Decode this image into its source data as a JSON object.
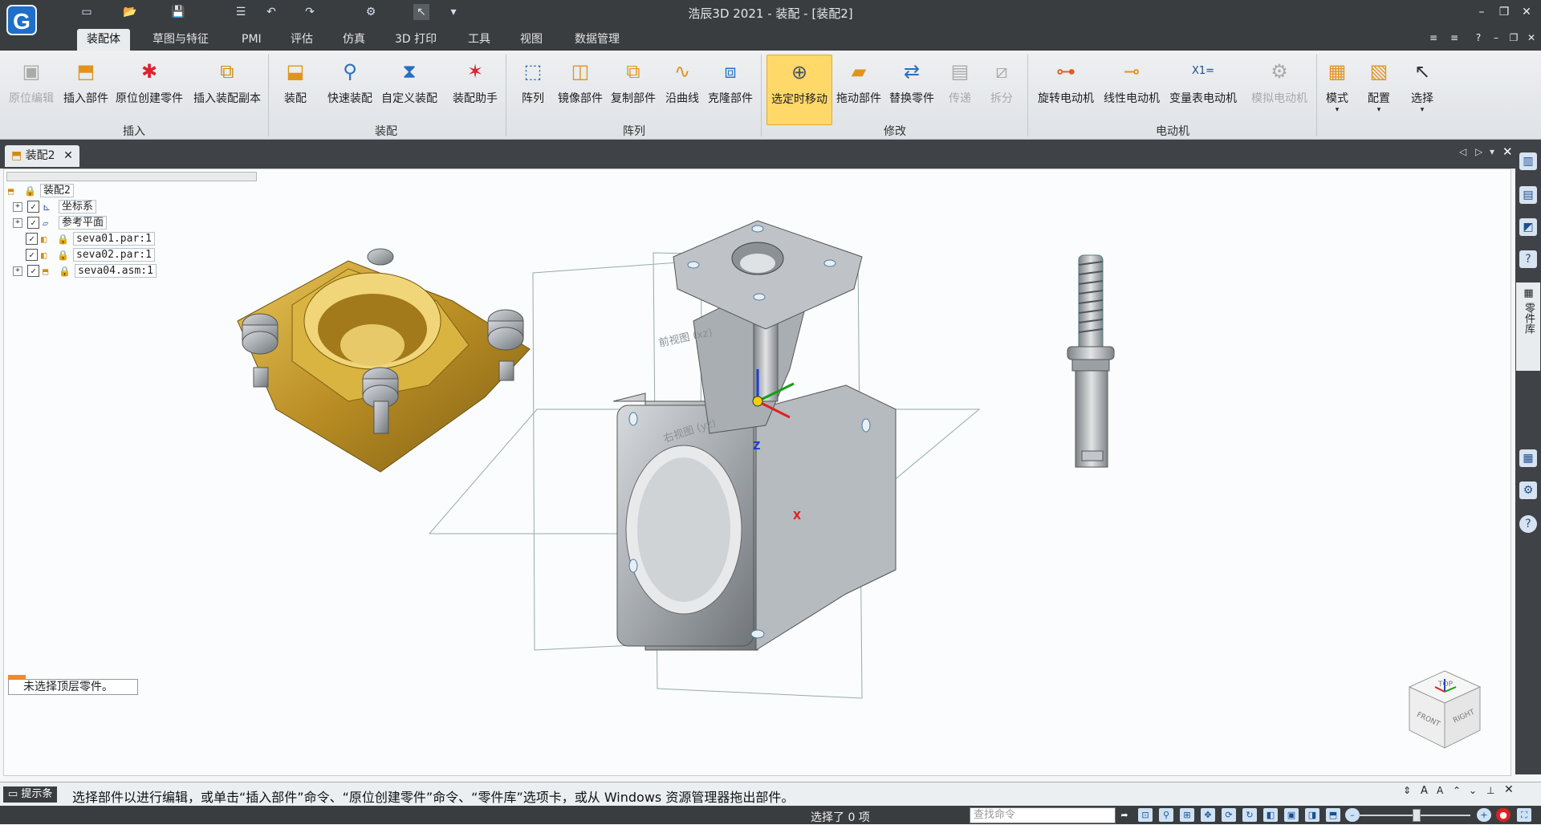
{
  "window": {
    "title": "浩辰3D 2021 - 装配 - [装配2]"
  },
  "quick_access_icons": [
    "new-icon",
    "open-icon",
    "save-icon",
    "undo-icon",
    "redo-icon",
    "select-icon"
  ],
  "ribbon_tabs": [
    {
      "label": "装配体",
      "active": true
    },
    {
      "label": "草图与特征"
    },
    {
      "label": "PMI"
    },
    {
      "label": "评估"
    },
    {
      "label": "仿真"
    },
    {
      "label": "3D 打印"
    },
    {
      "label": "工具"
    },
    {
      "label": "视图"
    },
    {
      "label": "数据管理"
    }
  ],
  "ribbon": {
    "groups": [
      "插入",
      "装配",
      "阵列",
      "修改",
      "电动机"
    ],
    "buttons": [
      {
        "label": "原位编辑",
        "disabled": true
      },
      {
        "label": "插入部件"
      },
      {
        "label": "原位创建零件"
      },
      {
        "label": "插入装配副本"
      },
      {
        "label": "装配"
      },
      {
        "label": "快速装配"
      },
      {
        "label": "自定义装配"
      },
      {
        "label": "装配助手"
      },
      {
        "label": "阵列"
      },
      {
        "label": "镜像部件"
      },
      {
        "label": "复制部件"
      },
      {
        "label": "沿曲线"
      },
      {
        "label": "克隆部件"
      },
      {
        "label": "选定时移动",
        "active": true
      },
      {
        "label": "拖动部件"
      },
      {
        "label": "替换零件"
      },
      {
        "label": "传递",
        "disabled": true
      },
      {
        "label": "拆分",
        "disabled": true
      },
      {
        "label": "旋转电动机"
      },
      {
        "label": "线性电动机"
      },
      {
        "label": "变量表电动机"
      },
      {
        "label": "模拟电动机",
        "disabled": true
      },
      {
        "label": "模式"
      },
      {
        "label": "配置"
      },
      {
        "label": "选择"
      }
    ]
  },
  "document_tab": {
    "label": "装配2"
  },
  "tree": {
    "root": "装配2",
    "items": [
      "坐标系",
      "参考平面",
      "seva01.par:1",
      "seva02.par:1",
      "seva04.asm:1"
    ]
  },
  "selection_status": "未选择顶层零件。",
  "viewport": {
    "plane_labels": [
      "前视图 (xz)",
      "右视图 (yz)"
    ],
    "axes": [
      "Z",
      "X"
    ],
    "view_cube": [
      "TOP",
      "FRONT",
      "RIGHT"
    ]
  },
  "side_panel": {
    "tab_label": "零件库"
  },
  "hint": {
    "label": "提示条",
    "text": "选择部件以进行编辑，或单击“插入部件”命令、“原位创建零件”命令、“零件库”选项卡，或从 Windows 资源管理器拖出部件。"
  },
  "statusbar": {
    "selected": "选择了 0 项",
    "search_placeholder": "查找命令"
  },
  "colors": {
    "chrome": "#3a3d40",
    "ribbon_active": "#ffd86a",
    "brass": "#c9a23a",
    "steel": "#9aa0a6"
  }
}
